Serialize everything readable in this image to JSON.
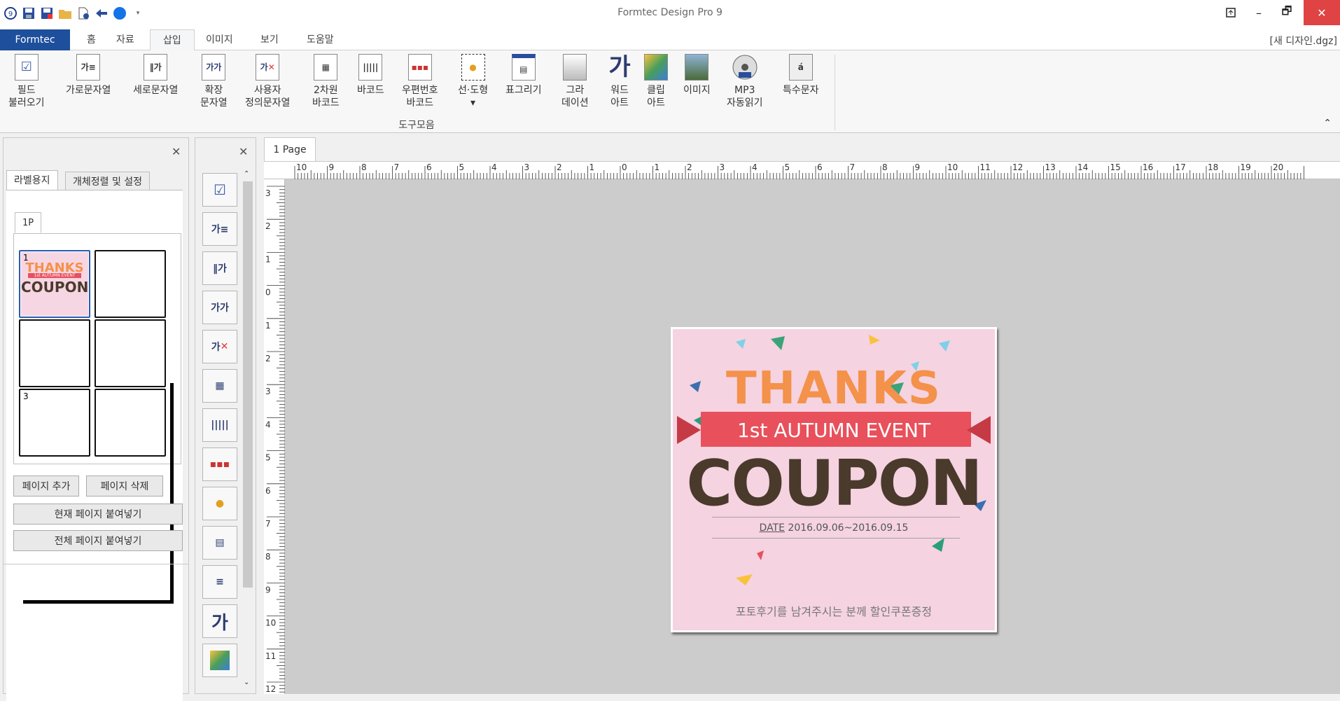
{
  "window": {
    "title": "Formtec Design Pro 9",
    "document": "[새 디자인.dgz]"
  },
  "quick_access": [
    "app-icon",
    "save-icon",
    "save-as-icon",
    "open-folder-icon",
    "new-document-icon",
    "undo-arrow-icon",
    "color-circle-icon",
    "dropdown-arrow-icon"
  ],
  "tabs": [
    "Formtec",
    "홈",
    "자료",
    "삽입",
    "이미지",
    "보기",
    "도움말"
  ],
  "active_tab": "삽입",
  "ribbon": {
    "buttons": [
      {
        "l1": "필드",
        "l2": "불러오기",
        "icon": "field-load-icon"
      },
      {
        "l1": "가로문자열",
        "l2": "",
        "icon": "horizontal-text-icon"
      },
      {
        "l1": "세로문자열",
        "l2": "",
        "icon": "vertical-text-icon"
      },
      {
        "l1": "확장",
        "l2": "문자열",
        "icon": "extended-text-icon"
      },
      {
        "l1": "사용자",
        "l2": "정의문자열",
        "icon": "custom-text-icon"
      },
      {
        "l1": "2차원",
        "l2": "바코드",
        "icon": "qr-code-icon"
      },
      {
        "l1": "바코드",
        "l2": "",
        "icon": "barcode-icon"
      },
      {
        "l1": "우편번호",
        "l2": "바코드",
        "icon": "postal-barcode-icon"
      },
      {
        "l1": "선·도형",
        "l2": "▾",
        "icon": "shape-icon"
      },
      {
        "l1": "표그리기",
        "l2": "",
        "icon": "table-icon"
      },
      {
        "l1": "그라",
        "l2": "데이션",
        "icon": "gradation-icon"
      },
      {
        "l1": "워드",
        "l2": "아트",
        "icon": "word-art-icon"
      },
      {
        "l1": "클립",
        "l2": "아트",
        "icon": "clip-art-icon"
      },
      {
        "l1": "이미지",
        "l2": "",
        "icon": "image-icon"
      },
      {
        "l1": "MP3",
        "l2": "자동읽기",
        "icon": "mp3-icon"
      },
      {
        "l1": "특수문자",
        "l2": "",
        "icon": "special-char-icon"
      }
    ],
    "group_label": "도구모음"
  },
  "left_panel": {
    "tabs": [
      "라벨용지",
      "개체정렬 및 설정"
    ],
    "page_tab": "1P",
    "cells": [
      "1",
      "",
      "",
      "",
      "3",
      ""
    ],
    "buttons": {
      "add": "페이지 추가",
      "delete": "페이지 삭제",
      "paste_current": "현재 페이지 붙여넣기",
      "paste_all": "전체 페이지 붙여넣기"
    }
  },
  "canvas": {
    "page_tab": "1 Page",
    "hruler_labels": [
      "10",
      "9",
      "8",
      "7",
      "6",
      "5",
      "4",
      "3",
      "2",
      "1",
      "0",
      "1",
      "2",
      "3",
      "4",
      "5",
      "6",
      "7",
      "8",
      "9",
      "10",
      "11",
      "12",
      "13",
      "14",
      "15",
      "16",
      "17",
      "18",
      "19",
      "20"
    ],
    "vruler_labels": [
      "3",
      "2",
      "1",
      "0",
      "1",
      "2",
      "3",
      "4",
      "5",
      "6",
      "7",
      "8",
      "9",
      "10",
      "11",
      "12"
    ]
  },
  "coupon": {
    "thanks": "THANKS",
    "banner": "1st AUTUMN EVENT",
    "coupon": "COUPON",
    "date_label": "DATE",
    "date": "2016.09.06~2016.09.15",
    "footer": "포토후기를 남겨주시는 분께 할인쿠폰증정",
    "thumb_thanks": "THANKS",
    "thumb_banner": "1st AUTUMN EVENT",
    "thumb_coupon": "COUPON"
  },
  "colors": {
    "accent": "#1d4f9c",
    "close": "#e04343",
    "coupon_bg": "#f5d3e1",
    "banner": "#e8505b",
    "thanks": "#f4914a",
    "coupon_text": "#4a3a2c"
  }
}
